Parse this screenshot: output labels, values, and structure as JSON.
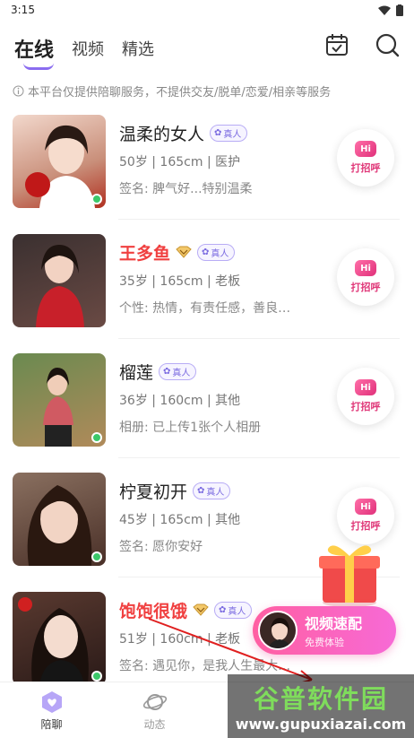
{
  "status_bar": {
    "time": "3:15"
  },
  "header": {
    "tabs": [
      {
        "label": "在线",
        "active": true
      },
      {
        "label": "视频",
        "active": false
      },
      {
        "label": "精选",
        "active": false
      }
    ],
    "calendar_icon": "calendar-check-icon",
    "search_icon": "search-icon"
  },
  "notice": "本平台仅提供陪聊服务，不提供交友/脱单/恋爱/相亲等服务",
  "badge_label": "真人",
  "greet_hi": "Hi",
  "greet_label": "打招呼",
  "users": [
    {
      "name": "温柔的女人",
      "vip": false,
      "meta": "50岁 | 165cm | 医护",
      "sign": "签名: 脾气好...特别温柔",
      "online": true,
      "avatar_color": "#d9b8a8"
    },
    {
      "name": "王多鱼",
      "vip": true,
      "meta": "35岁 | 165cm | 老板",
      "sign": "个性: 热情，有责任感，善良…",
      "online": false,
      "avatar_color": "#8a3a3a"
    },
    {
      "name": "榴莲",
      "vip": false,
      "meta": "36岁 | 160cm | 其他",
      "sign": "相册: 已上传1张个人相册",
      "online": true,
      "avatar_color": "#5b7a4a"
    },
    {
      "name": "柠夏初开",
      "vip": false,
      "meta": "45岁 | 165cm | 其他",
      "sign": "签名: 愿你安好",
      "online": true,
      "avatar_color": "#6e5048"
    },
    {
      "name": "饱饱很饿",
      "vip": true,
      "meta": "51岁 | 160cm | 老板",
      "sign": "签名: 遇见你，是我人生最大…",
      "online": true,
      "avatar_color": "#3a2a2a"
    }
  ],
  "video_match": {
    "title": "视频速配",
    "subtitle": "免费体验"
  },
  "bottom_nav": [
    {
      "label": "陪聊",
      "active": true,
      "icon": "chat-heart-icon"
    },
    {
      "label": "动态",
      "active": false,
      "icon": "planet-icon"
    }
  ],
  "watermark": {
    "main": "谷普软件园",
    "url": "www.gupuxiazai.com"
  },
  "colors": {
    "accent": "#8a6cf0",
    "vip_name": "#f04040",
    "greet": "#e03a7a",
    "online": "#3cc86a"
  }
}
